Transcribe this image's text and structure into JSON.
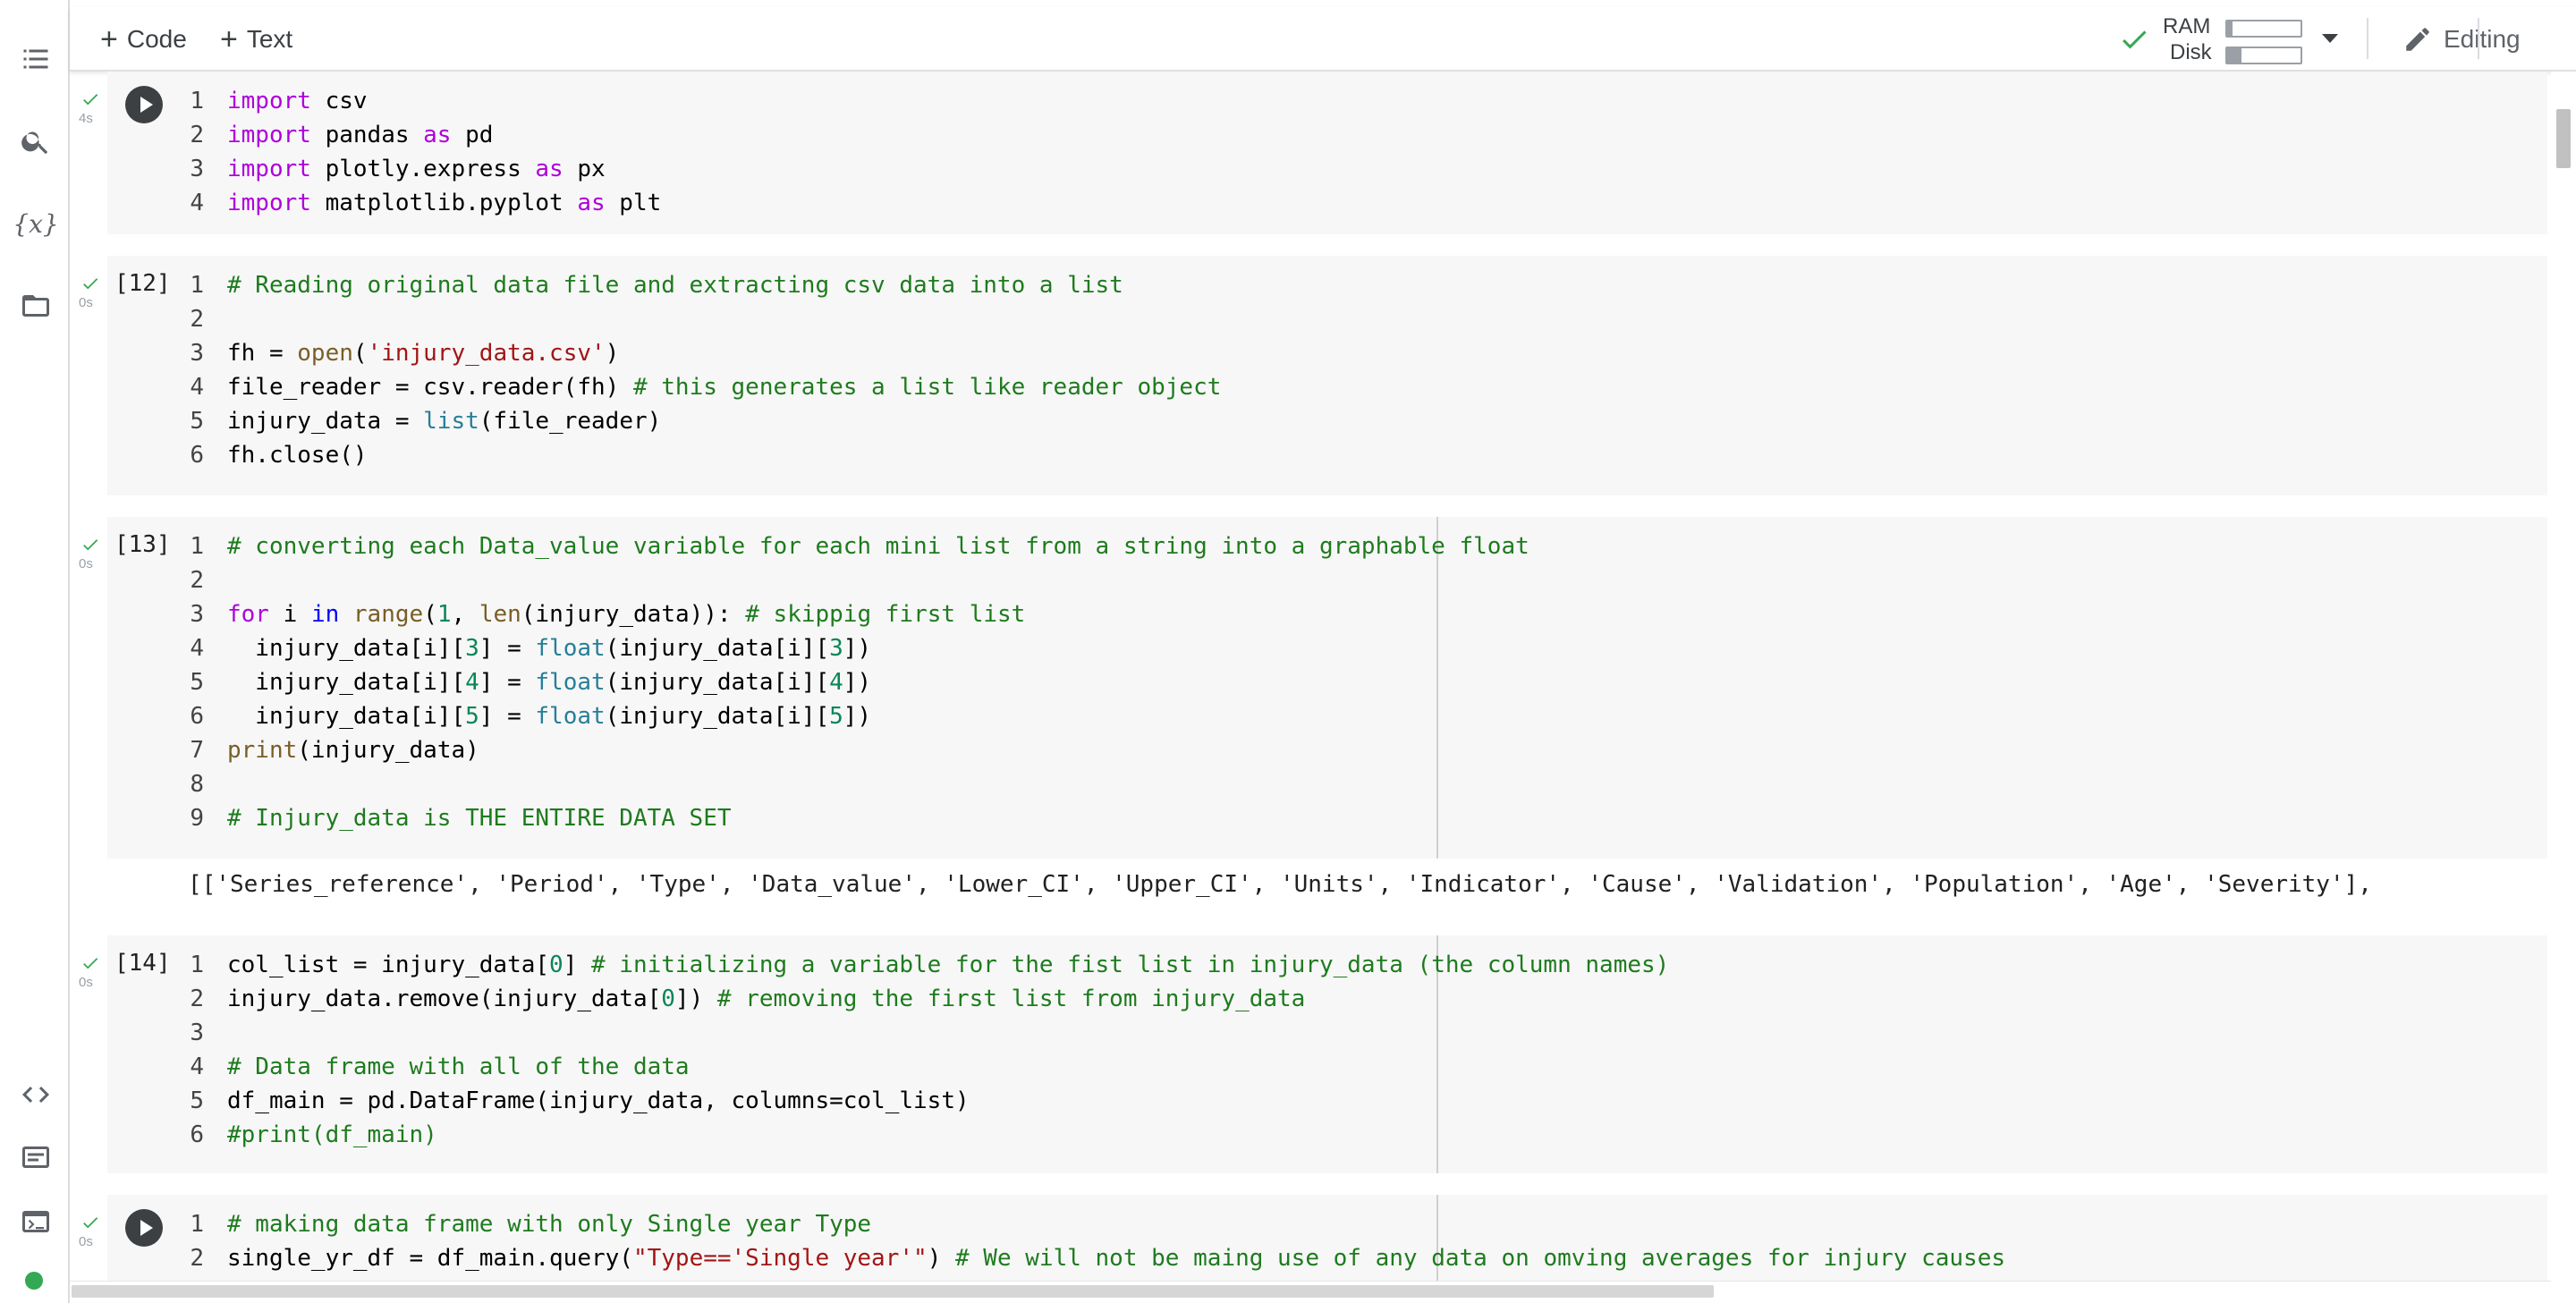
{
  "toolbar": {
    "add_code_label": "Code",
    "add_text_label": "Text",
    "ram_label": "RAM",
    "disk_label": "Disk",
    "ram_usage": 0.07,
    "disk_usage": 0.2,
    "editing_label": "Editing"
  },
  "sidebar": {
    "items": [
      "table-of-contents-icon",
      "search-icon",
      "variables-icon",
      "folder-icon"
    ],
    "variables_glyph": "{x}",
    "bottom_items": [
      "code-snippets-icon",
      "command-palette-icon",
      "terminal-icon"
    ]
  },
  "cells": [
    {
      "exec_label": "",
      "time": "4s",
      "lines": [
        "import csv",
        "import pandas as pd",
        "import plotly.express as px",
        "import matplotlib.pyplot as plt"
      ]
    },
    {
      "exec_label": "[12]",
      "time": "0s",
      "lines": [
        "# Reading original data file and extracting csv data into a list",
        "",
        "fh = open('injury_data.csv')",
        "file_reader = csv.reader(fh) # this generates a list like reader object",
        "injury_data = list(file_reader)",
        "fh.close()"
      ]
    },
    {
      "exec_label": "[13]",
      "time": "0s",
      "lines": [
        "# converting each Data_value variable for each mini list from a string into a graphable float",
        "",
        "for i in range(1, len(injury_data)): # skippig first list",
        "  injury_data[i][3] = float(injury_data[i][3])",
        "  injury_data[i][4] = float(injury_data[i][4])",
        "  injury_data[i][5] = float(injury_data[i][5])",
        "print(injury_data)",
        "",
        "# Injury_data is THE ENTIRE DATA SET"
      ],
      "output": "[['Series_reference', 'Period', 'Type', 'Data_value', 'Lower_CI', 'Upper_CI', 'Units', 'Indicator', 'Cause', 'Validation', 'Population', 'Age', 'Severity'],"
    },
    {
      "exec_label": "[14]",
      "time": "0s",
      "lines": [
        "col_list = injury_data[0] # initializing a variable for the fist list in injury_data (the column names)",
        "injury_data.remove(injury_data[0]) # removing the first list from injury_data",
        "",
        "# Data frame with all of the data",
        "df_main = pd.DataFrame(injury_data, columns=col_list)",
        "#print(df_main)"
      ]
    },
    {
      "exec_label": "",
      "time": "0s",
      "lines": [
        "# making data frame with only Single year Type",
        "single_yr_df = df_main.query(\"Type=='Single year'\") # We will not be maing use of any data on omving averages for injury causes"
      ]
    }
  ]
}
